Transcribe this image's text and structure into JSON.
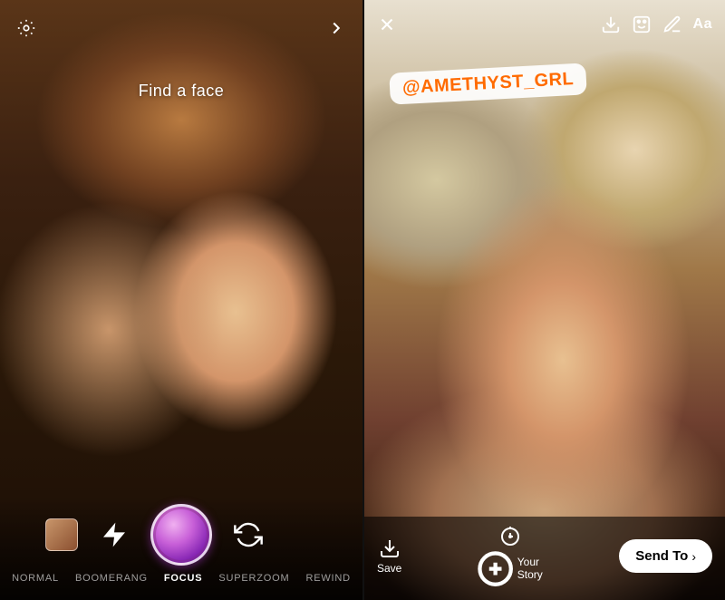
{
  "left": {
    "find_face_label": "Find a face",
    "modes": [
      {
        "id": "normal",
        "label": "NORMAL",
        "active": false
      },
      {
        "id": "boomerang",
        "label": "BOOMERANG",
        "active": false
      },
      {
        "id": "focus",
        "label": "FOCUS",
        "active": true
      },
      {
        "id": "superzoom",
        "label": "SUPERZOOM",
        "active": false
      },
      {
        "id": "rewind",
        "label": "REWIND",
        "active": false
      }
    ]
  },
  "right": {
    "mention": "@AMETHYST_GRL",
    "aa_label": "Aa",
    "save_label": "Save",
    "your_story_label": "Your Story",
    "send_to_label": "Send To"
  },
  "colors": {
    "accent_orange": "#FF6B00",
    "shutter_purple": "#9030a0",
    "white": "#ffffff",
    "black": "#000000"
  }
}
